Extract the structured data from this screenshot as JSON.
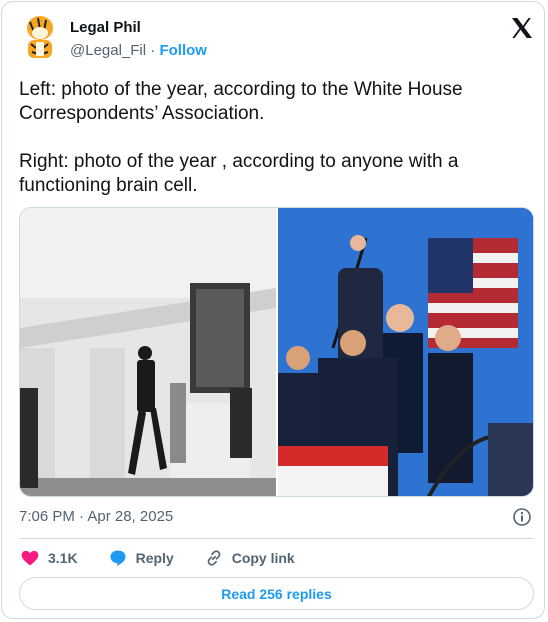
{
  "tweet": {
    "author_name": "Legal Phil",
    "handle": "@Legal_Fil",
    "separator": "·",
    "follow_label": "Follow",
    "text": "Left: photo of the year, according to the White House Correspondents’ Association.\n\nRight: photo of the year , according to anyone with a functioning brain cell.",
    "timestamp": "7:06 PM · Apr 28, 2025"
  },
  "actions": {
    "like_count": "3.1K",
    "reply_label": "Reply",
    "copy_link_label": "Copy link"
  },
  "footer": {
    "read_replies_label": "Read 256 replies"
  },
  "icons": {
    "brand": "x-logo-icon",
    "info": "info-icon",
    "like": "heart-icon",
    "reply": "reply-bubble-icon",
    "link": "link-icon"
  },
  "colors": {
    "accent": "#1d9bf0",
    "like": "#f91880",
    "border": "#cfd9de",
    "secondary_text": "#536471"
  }
}
